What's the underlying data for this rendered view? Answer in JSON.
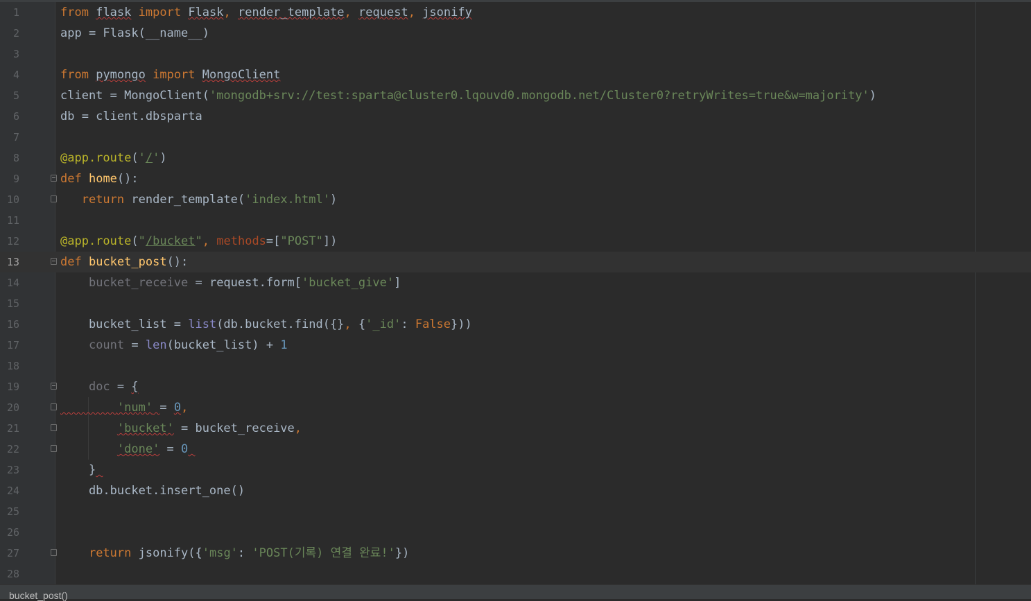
{
  "editor": {
    "current_line": 13,
    "breadcrumb": "bucket_post()",
    "lines": [
      {
        "n": "1",
        "text": "from flask import Flask, render_template, request, jsonify"
      },
      {
        "n": "2",
        "text": "app = Flask(__name__)"
      },
      {
        "n": "3",
        "text": ""
      },
      {
        "n": "4",
        "text": "from pymongo import MongoClient"
      },
      {
        "n": "5",
        "text": "client = MongoClient('mongodb+srv://test:sparta@cluster0.lqouvd0.mongodb.net/Cluster0?retryWrites=true&w=majority')"
      },
      {
        "n": "6",
        "text": "db = client.dbsparta"
      },
      {
        "n": "7",
        "text": ""
      },
      {
        "n": "8",
        "text": "@app.route('/')"
      },
      {
        "n": "9",
        "text": "def home():"
      },
      {
        "n": "10",
        "text": "   return render_template('index.html')"
      },
      {
        "n": "11",
        "text": ""
      },
      {
        "n": "12",
        "text": "@app.route(\"/bucket\", methods=[\"POST\"])"
      },
      {
        "n": "13",
        "text": "def bucket_post():"
      },
      {
        "n": "14",
        "text": "    bucket_receive = request.form['bucket_give']"
      },
      {
        "n": "15",
        "text": ""
      },
      {
        "n": "16",
        "text": "    bucket_list = list(db.bucket.find({}, {'_id': False}))"
      },
      {
        "n": "17",
        "text": "    count = len(bucket_list) + 1"
      },
      {
        "n": "18",
        "text": ""
      },
      {
        "n": "19",
        "text": "    doc = {"
      },
      {
        "n": "20",
        "text": "        'num' = 0,"
      },
      {
        "n": "21",
        "text": "        'bucket' = bucket_receive,"
      },
      {
        "n": "22",
        "text": "        'done' = 0"
      },
      {
        "n": "23",
        "text": "    }"
      },
      {
        "n": "24",
        "text": "    db.bucket.insert_one()"
      },
      {
        "n": "25",
        "text": ""
      },
      {
        "n": "26",
        "text": ""
      },
      {
        "n": "27",
        "text": "    return jsonify({'msg': 'POST(기록) 연결 완료!'})"
      },
      {
        "n": "28",
        "text": ""
      }
    ]
  },
  "colors": {
    "background": "#2b2b2b",
    "keyword": "#cc7832",
    "string": "#6a8759",
    "decorator": "#bbb529",
    "function": "#ffc66d",
    "number": "#6897bb",
    "builtin": "#8888c6",
    "identifier": "#a9b7c6"
  }
}
